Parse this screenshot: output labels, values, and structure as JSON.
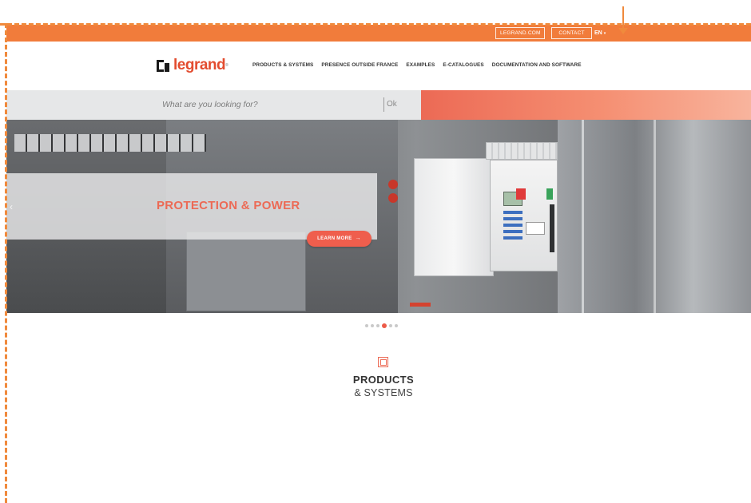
{
  "topbar": {
    "legrand_link": "LEGRAND.COM",
    "contact_link": "CONTACT",
    "language": "EN",
    "language_caret": "▾"
  },
  "brand": {
    "logo_text": "legrand",
    "logo_reg": "®"
  },
  "nav": {
    "items": [
      "PRODUCTS & SYSTEMS",
      "PRESENCE OUTSIDE FRANCE",
      "EXAMPLES",
      "E-CATALOGUES",
      "DOCUMENTATION AND SOFTWARE"
    ]
  },
  "search": {
    "placeholder": "What are you looking for?",
    "submit_label": "Ok"
  },
  "hero": {
    "title": "PROTECTION & POWER",
    "cta_label": "LEARN MORE",
    "cta_arrow": "→",
    "prev_glyph": "‹"
  },
  "carousel": {
    "slide_count": 6,
    "active_index": 3
  },
  "section": {
    "title": "PRODUCTS",
    "subtitle": "& SYSTEMS",
    "icon": "square-icon"
  },
  "colors": {
    "accent_orange": "#f17c3b",
    "accent_coral": "#ec6a55",
    "cta_red": "#ef5e4d"
  }
}
